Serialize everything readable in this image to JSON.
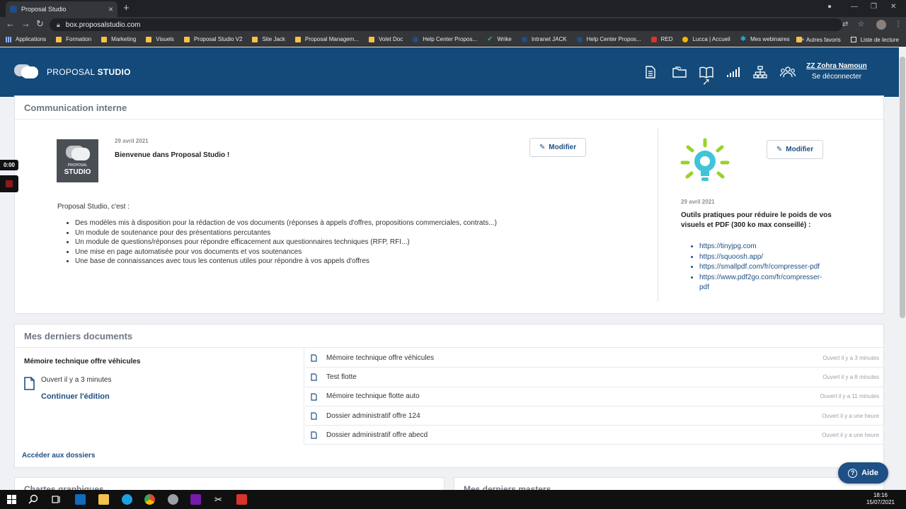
{
  "browser": {
    "tab_title": "Proposal Studio",
    "url": "box.proposalstudio.com",
    "bookmarks": [
      {
        "label": "Applications",
        "icon": "grid-icon"
      },
      {
        "label": "Formation",
        "icon": "folder-icon"
      },
      {
        "label": "Marketing",
        "icon": "folder-icon"
      },
      {
        "label": "Visuels",
        "icon": "folder-icon"
      },
      {
        "label": "Proposal Studio V2",
        "icon": "folder-icon"
      },
      {
        "label": "Site Jack",
        "icon": "folder-icon"
      },
      {
        "label": "Proposal Managem...",
        "icon": "folder-icon"
      },
      {
        "label": "Volet Doc",
        "icon": "folder-icon"
      },
      {
        "label": "Help Center Propos...",
        "icon": "site-icon"
      },
      {
        "label": "Wrike",
        "icon": "check-icon"
      },
      {
        "label": "Intranet JACK",
        "icon": "site-icon"
      },
      {
        "label": "Help Center Propos...",
        "icon": "site-icon"
      },
      {
        "label": "RED",
        "icon": "red-icon"
      },
      {
        "label": "Lucca | Accueil",
        "icon": "bulb-icon"
      },
      {
        "label": "Mes webinaires",
        "icon": "snowflake-icon"
      }
    ],
    "bookmarks_more": "»",
    "bookmark_other": "Autres favoris",
    "bookmark_reading": "Liste de lecture"
  },
  "header": {
    "logo_light": "PROPOSAL ",
    "logo_bold": "STUDIO",
    "user_name": "ZZ Zohra Namoun",
    "logout": "Se déconnecter",
    "nav_icons": [
      "document-icon",
      "folder-icon",
      "book-icon",
      "chart-icon",
      "hierarchy-icon",
      "users-icon"
    ]
  },
  "recorder": {
    "timer": "0:00"
  },
  "communication": {
    "title": "Communication interne",
    "modify_label": "Modifier",
    "card1": {
      "logo_small": "PROPOSAL",
      "logo_big": "STUDIO",
      "date": "29 avril 2021",
      "title": "Bienvenue dans Proposal Studio !",
      "intro": "Proposal Studio, c'est :",
      "items": [
        "Des modèles mis à disposition pour la rédaction de vos documents (réponses à appels d'offres, propositions commerciales, contrats...)",
        "Un module de soutenance pour des présentations percutantes",
        "Un module de questions/réponses pour répondre efficacement aux questionnaires techniques (RFP, RFI...)",
        "Une mise en page automatisée pour vos documents et vos soutenances",
        "Une base de connaissances avec tous les contenus utiles pour répondre à vos appels d'offres"
      ]
    },
    "card2": {
      "date": "29 avril 2021",
      "title": "Outils pratiques pour réduire le poids de vos visuels et PDF (300 ko max conseillé) :",
      "links": [
        "https://tinyjpg.com",
        "https://squoosh.app/",
        "https://smallpdf.com/fr/compresser-pdf",
        "https://www.pdf2go.com/fr/compresser-pdf"
      ]
    }
  },
  "documents": {
    "title": "Mes derniers documents",
    "featured": {
      "title": "Mémoire technique offre véhicules",
      "opened": "Ouvert il y a 3 minutes",
      "continue": "Continuer l'édition"
    },
    "rows": [
      {
        "name": "Mémoire technique offre véhicules",
        "when": "Ouvert il y a 3 minutes"
      },
      {
        "name": "Test flotte",
        "when": "Ouvert il y a 8 minutes"
      },
      {
        "name": "Mémoire technique flotte auto",
        "when": "Ouvert il y a 11 minutes"
      },
      {
        "name": "Dossier administratif offre 124",
        "when": "Ouvert il y a une heure"
      },
      {
        "name": "Dossier administratif offre abecd",
        "when": "Ouvert il y a une heure"
      }
    ],
    "footer_link": "Accéder aux dossiers"
  },
  "bottom_panels": {
    "left_title": "Chartes graphiques",
    "right_title": "Mes derniers masters"
  },
  "help": {
    "label": "Aide",
    "icon": "?"
  },
  "taskbar": {
    "time": "18:16",
    "date": "15/07/2021"
  },
  "colors": {
    "primary": "#134a7a",
    "link": "#1e4f86",
    "bulb": "#40c4d8",
    "bulb_rays": "#9bd02a"
  }
}
